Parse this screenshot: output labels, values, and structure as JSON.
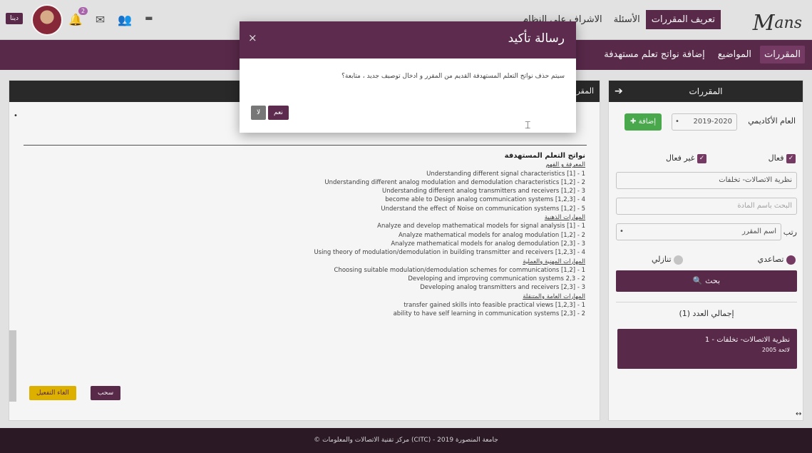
{
  "header": {
    "logo": "Mans",
    "nav": [
      {
        "label": "تعريف المقررات",
        "active": true
      },
      {
        "label": "الأسئلة",
        "active": false
      },
      {
        "label": "الاشراف على النظام",
        "active": false
      }
    ],
    "language_button": "دينا",
    "notification_count": "2"
  },
  "subnav": {
    "items": [
      {
        "label": "المقررات",
        "active": true
      },
      {
        "label": "المواضيع",
        "active": false
      },
      {
        "label": "إضافة نواتج تعلم مستهدفة",
        "active": false
      }
    ]
  },
  "sidebar": {
    "title": "المقررات",
    "academic_year_label": "العام الأكاديمي",
    "academic_year_value": "2019-2020",
    "add_button": "إضافة",
    "active_label": "فعال",
    "inactive_label": "غير فعال",
    "course_field_value": "نظرية الاتصالات- تخلفات",
    "search_name_placeholder": "البحث باسم المادة",
    "sort_label": "رتب بـ",
    "sort_value": "اسم المقرر",
    "ascending_label": "تصاعدي",
    "descending_label": "تنازلي",
    "search_button": "بحث",
    "total_label": "إجمالي العدد (1)",
    "course_card_title": "1 - نظرية الاتصالات- تخلفات",
    "course_card_sub": "لائحة 2005"
  },
  "main": {
    "panel_title": "المقرر",
    "outcomes_title": "نواتج التعلم المستهدفة",
    "sections": [
      {
        "title": "المعرفة و الفهم",
        "items": [
          "Understanding different signal characteristics [1] - 1",
          "Understanding different analog modulation and demodulation characteristics [1,2] - 2",
          "Understanding different analog transmitters and receivers [1,2] - 3",
          "become able to Design analog communication systems [1,2,3] - 4",
          "Understand the effect of Noise on communication systems [1,2] - 5"
        ]
      },
      {
        "title": "المهارات الذهنية",
        "items": [
          "Analyze and develop mathematical models for signal analysis [1] - 1",
          "Analyze mathematical models for analog modulation [1,2] - 2",
          "Analyze mathematical models for analog demodulation [2,3] - 3",
          "Using theory of modulation/demodulation in building transmitter and receivers [1,2,3] - 4"
        ]
      },
      {
        "title": "المهارات المهنية والعملية",
        "items": [
          "Choosing suitable modulation/demodulation schemes for communications [1,2] - 1",
          "Developing and improving communication systems 2,3 - 2",
          "Developing analog transmitters and receivers [2,3] - 3"
        ]
      },
      {
        "title": "المهارات العامة والمتنقلة",
        "items": [
          "transfer gained skills into feasible practical views [1,2,3] - 1",
          "ability to have self learning in communication systems [2,3] - 2"
        ]
      }
    ],
    "withdraw_button": "سحب",
    "cancel_activation_button": "الغاء التفعيل"
  },
  "footer": {
    "text": "© مركز تقنية الاتصالات والمعلومات (CITC) - جامعة المنصورة 2019"
  },
  "modal": {
    "title": "رسالة تأكيد",
    "message": "سيتم حذف نواتج التعلم المستهدفة القديم من المقرر و ادخال توصيف جديد ، متابعة؟",
    "yes": "نعم",
    "no": "لا",
    "close": "×"
  },
  "colors": {
    "primary": "#5d2b4e",
    "dark": "#2b2b2b",
    "success": "#4caf50",
    "warning": "#e6b800"
  }
}
